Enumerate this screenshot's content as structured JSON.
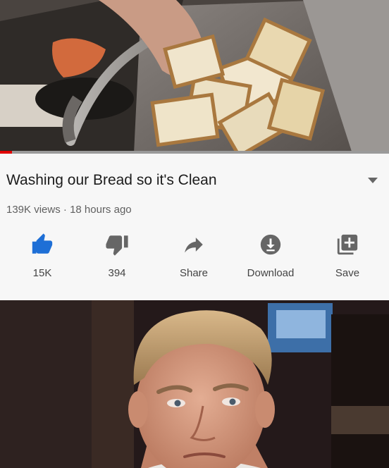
{
  "video": {
    "title": "Washing our Bread so it's Clean",
    "views": "139K views",
    "separator": "·",
    "age": "18 hours ago",
    "progress_fraction": 0.03
  },
  "actions": {
    "like_label": "15K",
    "dislike_label": "394",
    "share_label": "Share",
    "download_label": "Download",
    "save_label": "Save"
  },
  "icons": {
    "like": "thumbs-up-icon",
    "dislike": "thumbs-down-icon",
    "share": "share-arrow-icon",
    "download": "download-icon",
    "save": "add-to-playlist-icon",
    "expand": "chevron-down-icon"
  },
  "colors": {
    "like_active": "#1e6fd6",
    "icon": "#666666",
    "progress": "#e00000",
    "panel_bg": "#f7f7f7"
  }
}
